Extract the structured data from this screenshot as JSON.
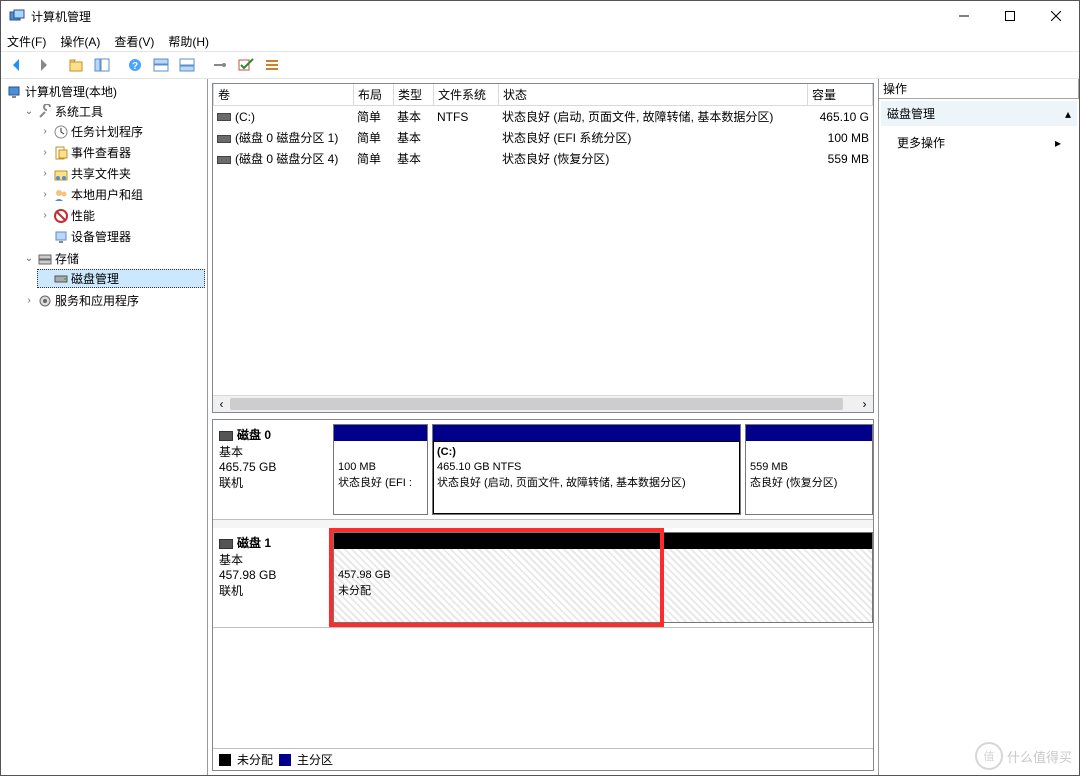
{
  "window": {
    "title": "计算机管理"
  },
  "menu": {
    "file": "文件(F)",
    "action": "操作(A)",
    "view": "查看(V)",
    "help": "帮助(H)"
  },
  "tree": {
    "root": "计算机管理(本地)",
    "system": "系统工具",
    "task": "任务计划程序",
    "event": "事件查看器",
    "shared": "共享文件夹",
    "users": "本地用户和组",
    "perf": "性能",
    "devmgr": "设备管理器",
    "storage": "存储",
    "diskmgmt": "磁盘管理",
    "services": "服务和应用程序"
  },
  "vol_headers": {
    "volume": "卷",
    "layout": "布局",
    "type": "类型",
    "fs": "文件系统",
    "status": "状态",
    "capacity": "容量"
  },
  "volumes": [
    {
      "icon": "disk",
      "name": "(C:)",
      "layout": "简单",
      "type": "基本",
      "fs": "NTFS",
      "status": "状态良好 (启动, 页面文件, 故障转储, 基本数据分区)",
      "cap": "465.10 G"
    },
    {
      "icon": "disk",
      "name": "(磁盘 0 磁盘分区 1)",
      "layout": "简单",
      "type": "基本",
      "fs": "",
      "status": "状态良好 (EFI 系统分区)",
      "cap": "100 MB"
    },
    {
      "icon": "disk",
      "name": "(磁盘 0 磁盘分区 4)",
      "layout": "简单",
      "type": "基本",
      "fs": "",
      "status": "状态良好 (恢复分区)",
      "cap": "559 MB"
    }
  ],
  "disk0": {
    "title": "磁盘 0",
    "type": "基本",
    "size": "465.75 GB",
    "status": "联机",
    "p1_size": "100 MB",
    "p1_status": "状态良好 (EFI :",
    "p2_title": "(C:)",
    "p2_size": "465.10 GB NTFS",
    "p2_status": "状态良好 (启动, 页面文件, 故障转储, 基本数据分区)",
    "p3_size": "559 MB",
    "p3_status": "态良好 (恢复分区)"
  },
  "disk1": {
    "title": "磁盘 1",
    "type": "基本",
    "size": "457.98 GB",
    "status": "联机",
    "u_size": "457.98 GB",
    "u_label": "未分配"
  },
  "legend": {
    "unalloc": "未分配",
    "primary": "主分区"
  },
  "actions": {
    "header": "操作",
    "section": "磁盘管理",
    "more": "更多操作"
  },
  "watermark": {
    "ball": "值",
    "text": "什么值得买"
  }
}
